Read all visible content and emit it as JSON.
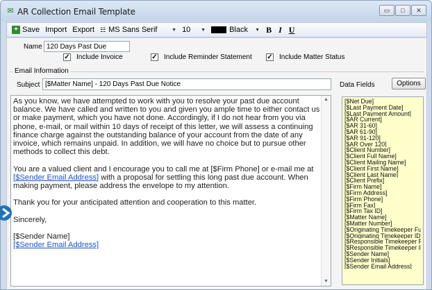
{
  "window": {
    "title": "AR Collection Email Template",
    "controls": [
      "minimize",
      "maximize",
      "close"
    ]
  },
  "toolbar": {
    "save_label": "Save",
    "import_label": "Import",
    "export_label": "Export",
    "font_name": "MS Sans Serif",
    "font_size": "10",
    "color_name": "Black",
    "bold_label": "B",
    "italic_label": "I",
    "underline_label": "U"
  },
  "form": {
    "name_label": "Name",
    "name_value": "120 Days Past Due",
    "checks": [
      {
        "label": "Include Invoice",
        "checked": true
      },
      {
        "label": "Include Reminder Statement",
        "checked": true
      },
      {
        "label": "Include Matter Status",
        "checked": true
      }
    ],
    "group_label": "Email Information",
    "subject_label": "Subject",
    "subject_value": "[$Matter Name] - 120 Days Past Due Notice",
    "data_fields_label": "Data Fields",
    "options_label": "Options"
  },
  "body": {
    "p1": "As you know, we have attempted to work with you to resolve your past due account balance.  We have called and written to you and given you ample time to either contact us or make payment, which you have not done.  Accordingly, if I do not hear from you via phone, e-mail, or mail within 10 days of receipt of this letter, we will assess a continuing finance charge against the outstanding balance of your account from the date of any invoice, which remains unpaid.  In addition, we will have no choice but to pursue other methods to collect this debt.",
    "p2_before": "You are a valued client and I encourage you to call me at [$Firm Phone] or e-mail me at ",
    "p2_link": "[$Sender Email Address]",
    "p2_after": " with a proposal for settling this long past due account.  When making payment, please address the envelope to my attention.",
    "p3": "Thank you for your anticipated attention and cooperation to this matter.",
    "closing": "Sincerely,",
    "sender_name": "[$Sender Name]",
    "sender_email": "[$Sender Email Address]"
  },
  "data_fields": [
    "[$Net Due]",
    "[$Last Payment Date]",
    "[$Last Payment Amount]",
    "[$AR Current]",
    "[$AR 31-60]",
    "[$AR 61-90]",
    "[$AR 91-120]",
    "[$AR Over 120]",
    "[$Client Number]",
    "[$Client Full Name]",
    "[$Client Mailing Name]",
    "[$Client First Name]",
    "[$Client Last Name]",
    "[$Client Prefix]",
    "[$Firm Name]",
    "[$Firm Address]",
    "[$Firm Phone]",
    "[$Firm Fax]",
    "[$Firm Tax ID]",
    "[$Matter Name]",
    "[$Matter Number]",
    "[$Originating Timekeeper Full Nam",
    "[$Originating Timekeeper ID]",
    "[$Responsible Timekeeper Full Na",
    "[$Responsible Timekeeper ID]",
    "[$Sender Name]",
    "[$Sender Initials]",
    "[$Sender Email Address]"
  ],
  "colors": {
    "titlebar": "#cfdceb",
    "fields_bg": "#ffffcc",
    "link": "#1a55c4",
    "pointer": "#1e73b8"
  }
}
